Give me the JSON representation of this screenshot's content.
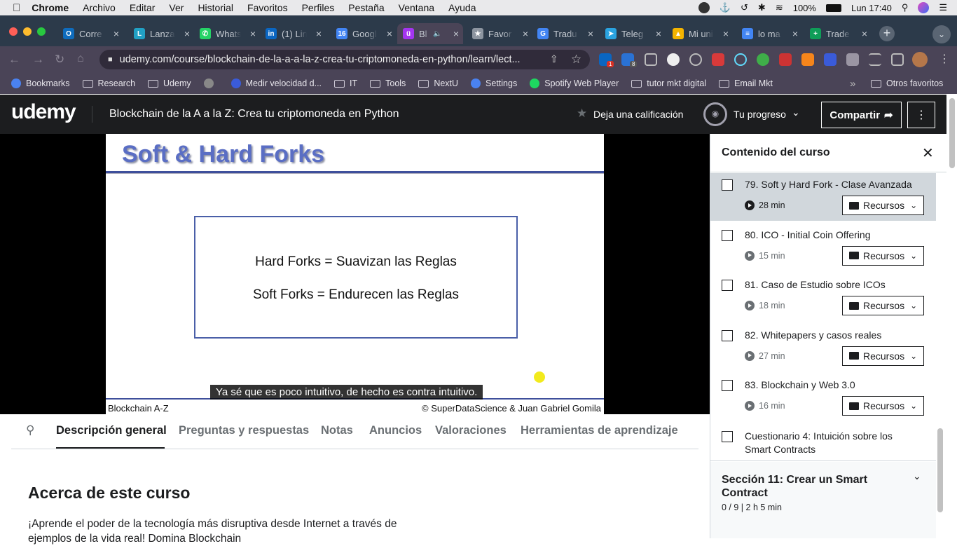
{
  "menubar": {
    "app": "Chrome",
    "items": [
      "Archivo",
      "Editar",
      "Ver",
      "Historial",
      "Favoritos",
      "Perfiles",
      "Pestaña",
      "Ventana",
      "Ayuda"
    ],
    "battery": "100%",
    "clock": "Lun 17:40"
  },
  "tabs": [
    {
      "title": "Corre",
      "color": "#0f6cbd",
      "glyph": "O"
    },
    {
      "title": "Lanza",
      "color": "#21a0c4",
      "glyph": "L"
    },
    {
      "title": "Whats",
      "color": "#25d366",
      "glyph": "✆"
    },
    {
      "title": "(1) Lin",
      "color": "#0a66c2",
      "glyph": "in"
    },
    {
      "title": "Googl",
      "color": "#4285f4",
      "glyph": "16"
    },
    {
      "title": "Bl",
      "color": "#a435f0",
      "glyph": "ü"
    },
    {
      "title": "Favor",
      "color": "#8d95a0",
      "glyph": "★"
    },
    {
      "title": "Tradu",
      "color": "#4285f4",
      "glyph": "G"
    },
    {
      "title": "Teleg",
      "color": "#2aa3e0",
      "glyph": "➤"
    },
    {
      "title": "Mi uni",
      "color": "#f4b400",
      "glyph": "▲"
    },
    {
      "title": "lo ma",
      "color": "#4285f4",
      "glyph": "≡"
    },
    {
      "title": "Trade",
      "color": "#0f9d58",
      "glyph": "+"
    }
  ],
  "omnibox": {
    "url": "udemy.com/course/blockchain-de-la-a-a-la-z-crea-tu-criptomoneda-en-python/learn/lect..."
  },
  "bookmarks": [
    {
      "label": "Bookmarks",
      "icon": "star-icon"
    },
    {
      "label": "Research",
      "icon": "folder-icon"
    },
    {
      "label": "Udemy",
      "icon": "folder-icon"
    },
    {
      "label": "",
      "icon": "globe-icon"
    },
    {
      "label": "Medir velocidad d...",
      "icon": "speed-icon"
    },
    {
      "label": "IT",
      "icon": "folder-icon"
    },
    {
      "label": "Tools",
      "icon": "folder-icon"
    },
    {
      "label": "NextU",
      "icon": "folder-icon"
    },
    {
      "label": "Settings",
      "icon": "gear-icon"
    },
    {
      "label": "Spotify Web Player",
      "icon": "spotify-icon"
    },
    {
      "label": "tutor mkt digital",
      "icon": "folder-icon"
    },
    {
      "label": "Email Mkt",
      "icon": "folder-icon"
    }
  ],
  "bookmarks_overflow": "»",
  "bookmarks_other": "Otros favoritos",
  "ext_badges": {
    "linkedin": "1",
    "mk": "8"
  },
  "udemy": {
    "logo": "udemy",
    "course_title": "Blockchain de la A a la Z: Crea tu criptomoneda en Python",
    "rate_label": "Deja una calificación",
    "progress_label": "Tu progreso",
    "share_label": "Compartir"
  },
  "slide": {
    "heading": "Soft & Hard Forks",
    "line1": "Hard Forks = Suavizan las Reglas",
    "line2": "Soft Forks = Endurecen las Reglas",
    "footer_left": "Blockchain A-Z",
    "footer_right": "© SuperDataScience & Juan Gabriel Gomila",
    "caption": "Ya sé que es poco intuitivo, de hecho es contra intuitivo."
  },
  "course_tabs": [
    "Descripción general",
    "Preguntas y respuestas",
    "Notas",
    "Anuncios",
    "Valoraciones",
    "Herramientas de aprendizaje"
  ],
  "about": {
    "heading": "Acerca de este curso",
    "text": "¡Aprende el poder de la tecnología más disruptiva desde Internet a través de ejemplos de la vida real! Domina Blockchain"
  },
  "sidebar": {
    "title": "Contenido del curso",
    "lessons": [
      {
        "title": "79. Soft y Hard Fork - Clase Avanzada",
        "duration": "28 min",
        "resources": "Recursos"
      },
      {
        "title": "80. ICO - Initial Coin Offering",
        "duration": "15 min",
        "resources": "Recursos"
      },
      {
        "title": "81. Caso de Estudio sobre ICOs",
        "duration": "18 min",
        "resources": "Recursos"
      },
      {
        "title": "82. Whitepapers y casos reales",
        "duration": "27 min",
        "resources": "Recursos"
      },
      {
        "title": "83. Blockchain y Web 3.0",
        "duration": "16 min",
        "resources": "Recursos"
      }
    ],
    "quiz": "Cuestionario 4: Intuición sobre los Smart Contracts",
    "section_title": "Sección 11: Crear un Smart Contract",
    "section_meta": "0 / 9 | 2 h 5 min"
  }
}
